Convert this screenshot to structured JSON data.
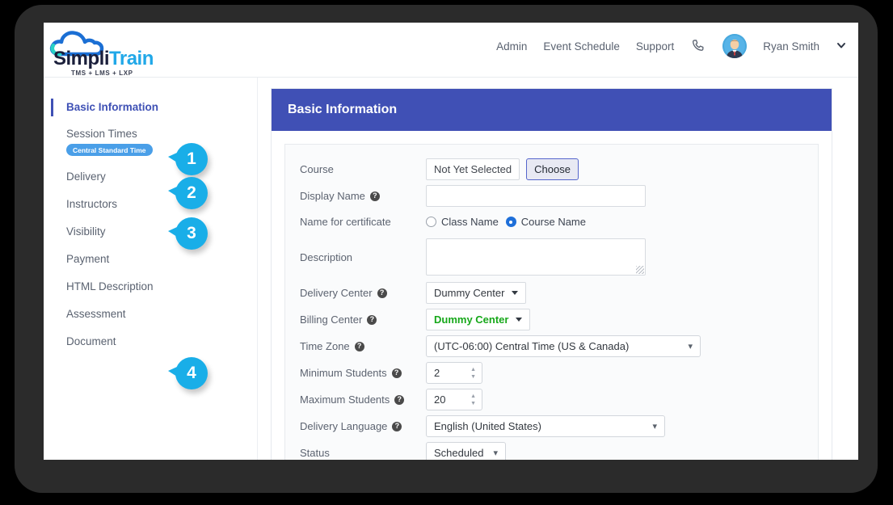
{
  "brand": {
    "name_part1": "Simpli",
    "name_part2": "Train",
    "tagline": "TMS + LMS + LXP",
    "accent": "#21a8e8"
  },
  "header": {
    "nav": [
      {
        "label": "Admin"
      },
      {
        "label": "Event Schedule"
      },
      {
        "label": "Support"
      }
    ],
    "phone_icon": "phone-icon",
    "user": {
      "name": "Ryan Smith",
      "chevron": "⌄"
    }
  },
  "sidebar": {
    "items": [
      {
        "label": "Basic Information",
        "active": true
      },
      {
        "label": "Session Times",
        "badge": "Central Standard Time"
      },
      {
        "label": "Delivery"
      },
      {
        "label": "Instructors"
      },
      {
        "label": "Visibility"
      },
      {
        "label": "Payment"
      },
      {
        "label": "HTML Description"
      },
      {
        "label": "Assessment"
      },
      {
        "label": "Document"
      }
    ],
    "callouts": [
      {
        "number": "1"
      },
      {
        "number": "2"
      },
      {
        "number": "3"
      },
      {
        "number": "4"
      }
    ],
    "active_accent": "#3f51b5",
    "badge_color": "#4a9fe8"
  },
  "panel": {
    "title": "Basic Information",
    "header_color": "#4050b5",
    "fields": {
      "course": {
        "label": "Course",
        "value": "Not Yet Selected",
        "button": "Choose"
      },
      "display_name": {
        "label": "Display Name",
        "value": "",
        "placeholder": ""
      },
      "name_for_certificate": {
        "label": "Name for certificate",
        "options": [
          {
            "label": "Class Name",
            "selected": false
          },
          {
            "label": "Course Name",
            "selected": true
          }
        ]
      },
      "description": {
        "label": "Description",
        "value": ""
      },
      "delivery_center": {
        "label": "Delivery Center",
        "value": "Dummy Center"
      },
      "billing_center": {
        "label": "Billing Center",
        "value": "Dummy Center",
        "value_color": "#17a81a"
      },
      "time_zone": {
        "label": "Time Zone",
        "value": "(UTC-06:00) Central Time (US & Canada)"
      },
      "minimum_students": {
        "label": "Minimum Students",
        "value": "2"
      },
      "maximum_students": {
        "label": "Maximum Students",
        "value": "20"
      },
      "delivery_language": {
        "label": "Delivery Language",
        "value": "English (United States)"
      },
      "status": {
        "label": "Status",
        "value": "Scheduled"
      }
    },
    "help_glyph": "?"
  }
}
